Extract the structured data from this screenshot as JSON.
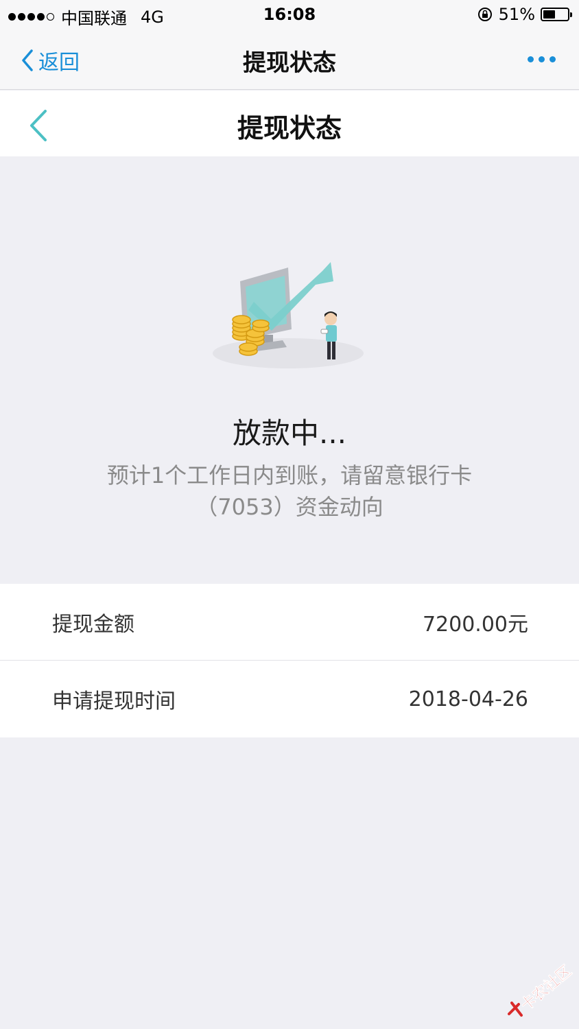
{
  "status_bar": {
    "carrier": "中国联通",
    "network": "4G",
    "time": "16:08",
    "battery": "51%",
    "battery_level": 0.51,
    "signal_bars": 4
  },
  "outer_nav": {
    "back_label": "返回",
    "title": "提现状态",
    "more_icon": "more-dots-icon"
  },
  "inner_nav": {
    "title": "提现状态",
    "back_icon": "chevron-left-icon"
  },
  "status": {
    "title": "放款中...",
    "description": "预计1个工作日内到账，请留意银行卡（7053）资金动向"
  },
  "details": [
    {
      "label": "提现金额",
      "value": "7200.00元"
    },
    {
      "label": "申请提现时间",
      "value": "2018-04-26"
    }
  ],
  "watermark": "卡农社区",
  "colors": {
    "accent": "#1a8fd8",
    "teal": "#4cc0c4",
    "background": "#efeff4",
    "desc_gray": "#8a8a8a"
  }
}
